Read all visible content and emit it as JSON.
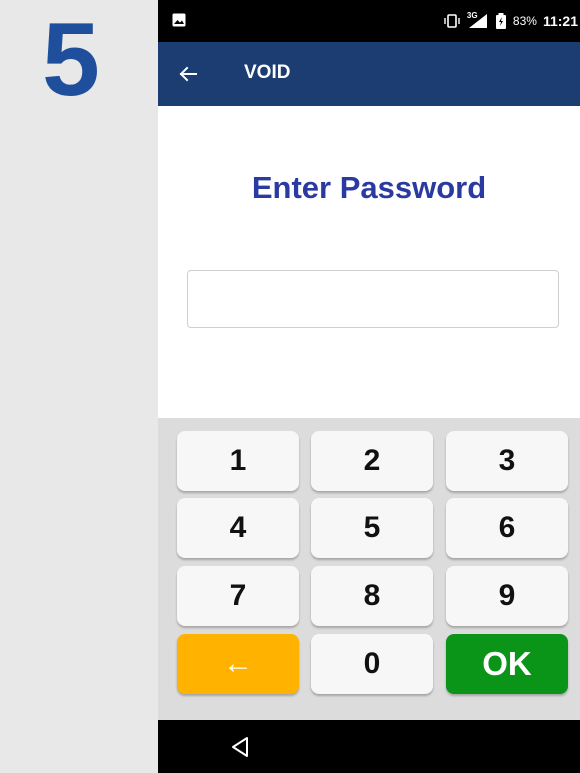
{
  "step_label": "5",
  "status_bar": {
    "network": "3G",
    "battery_percent": "83%",
    "time": "11:21",
    "icons": [
      "image-icon",
      "vibrate-icon",
      "signal-icon",
      "battery-icon"
    ]
  },
  "app_bar": {
    "title": "VOID",
    "back_icon": "arrow-left-icon"
  },
  "prompt": "Enter Password",
  "password_field": {
    "value": "",
    "placeholder": ""
  },
  "keypad": {
    "keys": {
      "k1": "1",
      "k2": "2",
      "k3": "3",
      "k4": "4",
      "k5": "5",
      "k6": "6",
      "k7": "7",
      "k8": "8",
      "k9": "9",
      "backspace": "←",
      "k0": "0",
      "ok": "OK"
    }
  },
  "colors": {
    "step_number": "#1f4e9c",
    "app_bar": "#1b3d72",
    "prompt": "#2b3aa0",
    "backspace_key": "#ffb300",
    "ok_key": "#0a9418"
  },
  "nav_bar": {
    "back_icon": "triangle-back-icon"
  }
}
